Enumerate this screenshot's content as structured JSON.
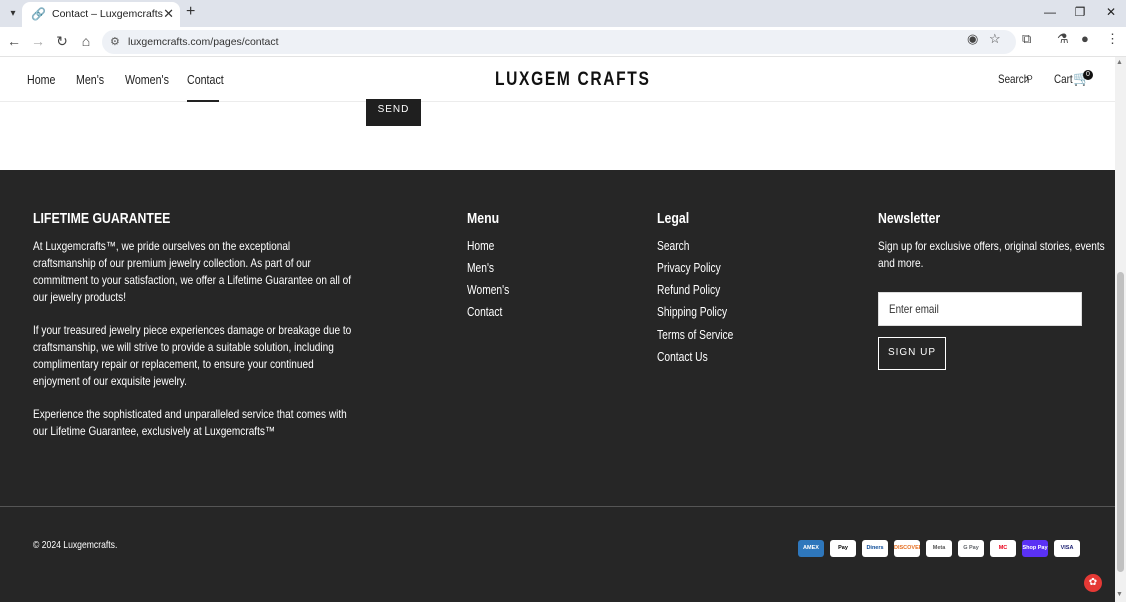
{
  "browser": {
    "tab_title": "Contact – Luxgemcrafts",
    "url": "luxgemcrafts.com/pages/contact"
  },
  "header": {
    "nav": [
      "Home",
      "Men's",
      "Women's",
      "Contact"
    ],
    "logo": "LUXGEM CRAFTS",
    "search_label": "Search",
    "cart_label": "Cart",
    "cart_count": "0"
  },
  "form": {
    "send_label": "SEND"
  },
  "footer": {
    "guarantee": {
      "heading": "LIFETIME GUARANTEE",
      "para1": [
        "At Luxgemcrafts™, we pride ourselves on the exceptional",
        "craftsmanship of our premium jewelry collection. As part of our",
        "commitment to your satisfaction, we offer a Lifetime Guarantee on all of",
        "our jewelry products!"
      ],
      "para2": [
        "If your treasured jewelry piece experiences damage or breakage due to",
        "craftsmanship, we will strive to provide a suitable solution, including",
        "complimentary repair or replacement, to ensure your continued",
        "enjoyment of our exquisite jewelry."
      ],
      "para3": [
        "Experience the sophisticated and unparalleled service that comes with",
        "our Lifetime Guarantee, exclusively at Luxgemcrafts™"
      ]
    },
    "menu": {
      "heading": "Menu",
      "links": [
        "Home",
        "Men's",
        "Women's",
        "Contact"
      ]
    },
    "legal": {
      "heading": "Legal",
      "links": [
        "Search",
        "Privacy Policy",
        "Refund Policy",
        "Shipping Policy",
        "Terms of Service",
        "Contact Us"
      ]
    },
    "newsletter": {
      "heading": "Newsletter",
      "text": [
        "Sign up for exclusive offers, original stories, events",
        "and more."
      ],
      "email_placeholder": "Enter email",
      "signup_label": "SIGN UP"
    },
    "copyright": "© 2024 Luxgemcrafts.",
    "payments": [
      "AMEX",
      "Pay",
      "Diners",
      "DISCOVER",
      "Meta",
      "G Pay",
      "MC",
      "Shop Pay",
      "VISA"
    ]
  },
  "colors": {
    "footer_bg": "#262626",
    "header_text": "#222222"
  }
}
